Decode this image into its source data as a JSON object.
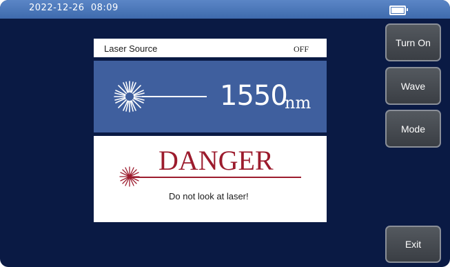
{
  "status_bar": {
    "datetime": "2022-12-26  08:09",
    "battery_icon": "battery-full-icon"
  },
  "laser_panel": {
    "title": "Laser Source",
    "state": "OFF",
    "wavelength_value": "1550",
    "wavelength_unit": "nm",
    "laser_icon": "laser-burst-icon"
  },
  "danger_panel": {
    "title": "DANGER",
    "message": "Do not look at laser!",
    "laser_icon": "laser-burst-icon"
  },
  "buttons": {
    "turn_on": "Turn On",
    "wave": "Wave",
    "mode": "Mode",
    "exit": "Exit"
  },
  "colors": {
    "background": "#0a1a44",
    "status_bar": "#4a78bb",
    "laser_panel": "#3f5f9e",
    "danger": "#9c1b2d"
  }
}
